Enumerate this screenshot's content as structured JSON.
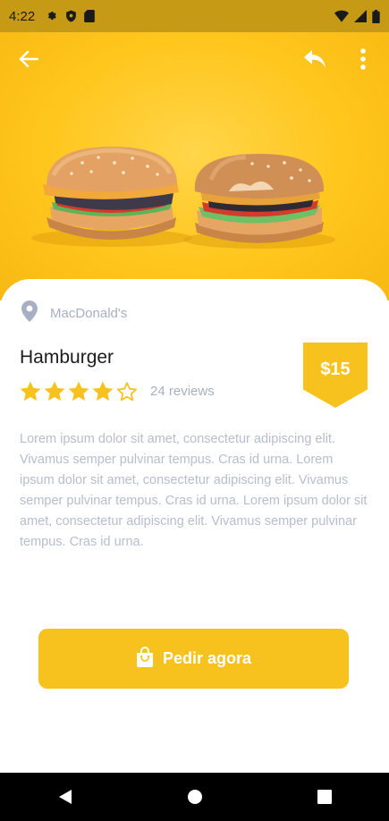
{
  "status_bar": {
    "time": "4:22",
    "icons": [
      "gear-icon",
      "shield-icon",
      "sd-card-icon",
      "wifi-icon",
      "signal-icon",
      "battery-icon"
    ]
  },
  "top_bar": {
    "icons": [
      "arrow-left-icon",
      "share-reply-icon",
      "more-vertical-icon"
    ]
  },
  "hero": {
    "image": "two-hamburgers-on-yellow-background"
  },
  "product": {
    "location": "MacDonald's",
    "name": "Hamburger",
    "price": "$15",
    "rating": 4,
    "rating_max": 5,
    "reviews": "24 reviews",
    "description": "Lorem ipsum dolor sit amet, consectetur adipiscing elit. Vivamus semper pulvinar tempus. Cras id urna. Lorem ipsum dolor sit amet, consectetur adipiscing elit. Vivamus semper pulvinar tempus. Cras id urna. Lorem ipsum dolor sit amet, consectetur adipiscing elit. Vivamus semper pulvinar tempus. Cras id urna."
  },
  "order_button": {
    "label": "Pedir agora",
    "icon": "shopping-bag-icon"
  },
  "nav_bar": {
    "icons": [
      "back-triangle-icon",
      "home-circle-icon",
      "recents-square-icon"
    ]
  },
  "colors": {
    "accent": "#f7c21e",
    "hero_background": "#ffc61c",
    "status_bar": "#c79a16",
    "muted_text": "#a7b0c2",
    "title_text": "#1b1b1b"
  }
}
